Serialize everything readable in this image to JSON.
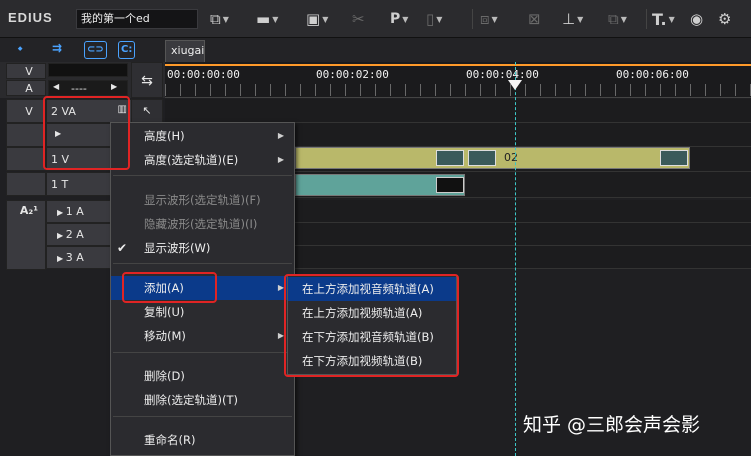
{
  "app": {
    "logo": "EDIUS",
    "project_name": "我的第一个ed"
  },
  "toolbar": {
    "items": [
      {
        "icon": "sequence-icon"
      },
      {
        "icon": "folder-icon"
      },
      {
        "icon": "save-icon"
      },
      {
        "icon": "scissors-icon"
      },
      {
        "icon": "p-text-icon",
        "label": "P"
      },
      {
        "icon": "export-icon"
      },
      {
        "icon": "copy-icon"
      },
      {
        "icon": "delete-icon"
      },
      {
        "icon": "marker-icon"
      },
      {
        "icon": "crop-icon"
      },
      {
        "icon": "title-icon",
        "label": "T."
      },
      {
        "icon": "capture-icon"
      },
      {
        "icon": "settings-icon"
      }
    ]
  },
  "sequence_tab": "xiugai",
  "ruler": {
    "timecodes": [
      "00:00:00:00",
      "00:00:02:00",
      "00:00:04:00",
      "00:00:06:00"
    ]
  },
  "track_header": {
    "v_label": "V",
    "a_label": "A",
    "channel_select": "----"
  },
  "tracks": [
    {
      "type": "V",
      "name": "2 VA"
    },
    {
      "type": "",
      "name": ""
    },
    {
      "type": "",
      "name": "1 V"
    },
    {
      "type": "",
      "name": "1 T"
    },
    {
      "type": "A",
      "name": "1 A"
    },
    {
      "type": "",
      "name": "2 A"
    },
    {
      "type": "",
      "name": "3 A"
    }
  ],
  "clips": {
    "video_clip_name": "02"
  },
  "context_menu": {
    "items": [
      {
        "label": "高度(H)",
        "submenu": true
      },
      {
        "label": "高度(选定轨道)(E)",
        "submenu": true
      },
      {
        "label": "显示波形(选定轨道)(F)",
        "disabled": true
      },
      {
        "label": "隐藏波形(选定轨道)(I)",
        "disabled": true
      },
      {
        "label": "显示波形(W)",
        "checked": true
      },
      {
        "label": "添加(A)",
        "submenu": true,
        "active": true
      },
      {
        "label": "复制(U)"
      },
      {
        "label": "移动(M)",
        "submenu": true
      },
      {
        "label": "删除(D)"
      },
      {
        "label": "删除(选定轨道)(T)"
      },
      {
        "label": "重命名(R)"
      }
    ],
    "add_submenu": [
      {
        "label": "在上方添加视音频轨道(A)",
        "active": true
      },
      {
        "label": "在上方添加视频轨道(A)"
      },
      {
        "label": "在下方添加视音频轨道(B)"
      },
      {
        "label": "在下方添加视频轨道(B)"
      }
    ]
  },
  "watermark": "知乎 @三郎会声会影",
  "colors": {
    "highlight": "#0b3a8a",
    "annotation_red": "#e02424",
    "playhead": "#3cc8c8",
    "ruler_bar": "#ff9a2a"
  }
}
